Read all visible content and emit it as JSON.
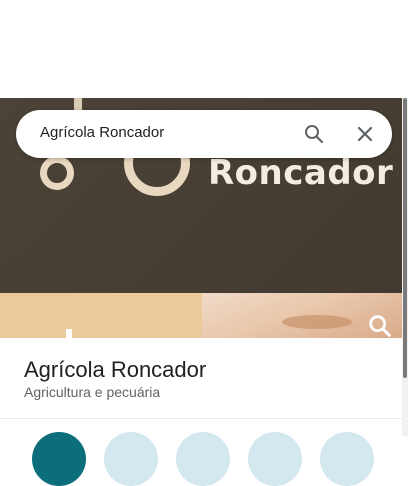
{
  "search": {
    "query": "Agrícola Roncador"
  },
  "hero": {
    "brand_text": "Roncador"
  },
  "place": {
    "name": "Agrícola Roncador",
    "category": "Agricultura e pecuária"
  },
  "icons": {
    "search": "search-icon",
    "close": "close-icon",
    "photo_search": "search-icon"
  },
  "colors": {
    "hero_bg": "#4a4238",
    "accent": "#0b6e7a",
    "text_primary": "#202124",
    "text_secondary": "#5f6368"
  }
}
